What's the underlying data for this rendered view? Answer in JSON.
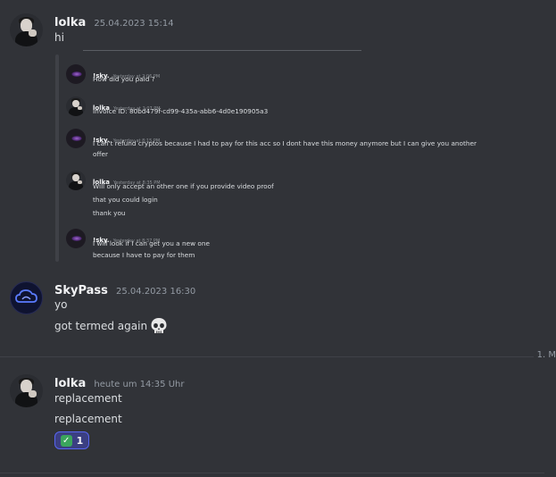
{
  "messages": {
    "m1": {
      "author": "lolka",
      "timestamp": "25.04.2023 15:14",
      "lines": [
        "hi"
      ]
    },
    "m2": {
      "author": "SkyPass",
      "timestamp": "25.04.2023 16:30",
      "lines": [
        "yo",
        "got termed again"
      ],
      "emoji": "skull-icon"
    },
    "m3": {
      "author": "lolka",
      "timestamp": "heute um 14:35 Uhr",
      "lines": [
        "replacement",
        "replacement"
      ]
    }
  },
  "embedded_messages": [
    {
      "author": "!sky.",
      "timestamp": "Yesterday at 2:06 PM",
      "lines": [
        "How did you paid ?"
      ]
    },
    {
      "author": "lolka",
      "timestamp": "Yesterday at 2:07 PM",
      "lines": [
        "Invoice ID: 80bd479f-cd99-435a-abb6-4d0e190905a3"
      ]
    },
    {
      "author": "!sky.",
      "timestamp": "Yesterday at 8:15 PM",
      "lines": [
        "I can't refund cryptos because I had to pay for this acc so I dont have this money anymore but I can give you another",
        "offer"
      ]
    },
    {
      "author": "lolka",
      "timestamp": "Yesterday at 8:35 PM",
      "lines": [
        "Will only accept an other one if you provide video proof",
        "that you could login",
        "thank you"
      ]
    },
    {
      "author": "!sky.",
      "timestamp": "Yesterday at 8:37 PM",
      "lines": [
        "I will look if I can get you a new one",
        "because I have to pay for them"
      ]
    }
  ],
  "date_divider": "1. M",
  "reaction": {
    "emoji": "check-mark-icon",
    "count": "1"
  },
  "colors": {
    "background": "#313338",
    "accent": "#5865f2",
    "reaction_bg": "#3b3f82",
    "check": "#3ba55c"
  }
}
